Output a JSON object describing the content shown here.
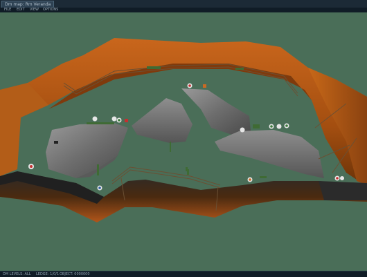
{
  "window": {
    "tab_label": "Dm map: Rm Veranda"
  },
  "menu": [
    "FILE",
    "EDIT",
    "VIEW",
    "OPTIONS"
  ],
  "scene": {
    "sky_color": "#4a6e58",
    "dirt_color": "#b25a16",
    "rock_color": "#7d7d7d",
    "fence_color": "#6b5033"
  },
  "status": [
    "DM LEVELS: ALL",
    "LEDGE: 1/0/1",
    "OBJECT: 0000000"
  ]
}
